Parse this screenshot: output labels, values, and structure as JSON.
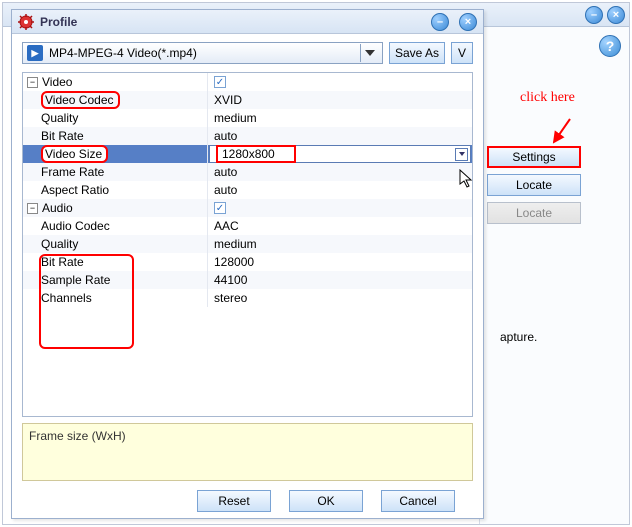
{
  "outer": {
    "min_glyph": "–",
    "close_glyph": "×"
  },
  "help_glyph": "?",
  "right": {
    "click_here": "click here",
    "settings": "Settings",
    "locate": "Locate",
    "locate_disabled": "Locate",
    "fragment": "apture."
  },
  "dialog": {
    "title": "Profile",
    "min_glyph": "–",
    "close_glyph": "×",
    "profile_value": "MP4-MPEG-4 Video(*.mp4)",
    "save_as": "Save As",
    "v_label": "V",
    "hint": "Frame size (WxH)",
    "buttons": {
      "reset": "Reset",
      "ok": "OK",
      "cancel": "Cancel"
    }
  },
  "grid": {
    "video_header": "Video",
    "video": {
      "codec_label": "Video Codec",
      "codec_value": "XVID",
      "quality_label": "Quality",
      "quality_value": "medium",
      "bitrate_label": "Bit Rate",
      "bitrate_value": "auto",
      "size_label": "Video Size",
      "size_value": "1280x800",
      "framerate_label": "Frame Rate",
      "framerate_value": "auto",
      "aspect_label": "Aspect Ratio",
      "aspect_value": "auto"
    },
    "audio_header": "Audio",
    "audio": {
      "codec_label": "Audio Codec",
      "codec_value": "AAC",
      "quality_label": "Quality",
      "quality_value": "medium",
      "bitrate_label": "Bit Rate",
      "bitrate_value": "128000",
      "samplerate_label": "Sample Rate",
      "samplerate_value": "44100",
      "channels_label": "Channels",
      "channels_value": "stereo"
    },
    "check_glyph": "✓",
    "minus_glyph": "−"
  }
}
